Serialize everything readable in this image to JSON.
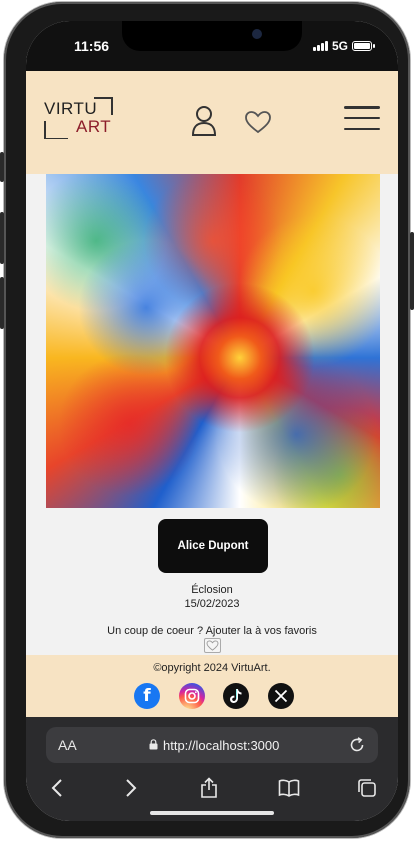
{
  "status_bar": {
    "time": "11:56",
    "network": "5G"
  },
  "header": {
    "logo_top": "VIRTU",
    "logo_bottom": "ART",
    "logo_accent_color": "#8c1d2a",
    "background_color": "#f7e3c3",
    "icons": [
      "user-icon",
      "heart-icon",
      "menu-icon"
    ]
  },
  "artwork": {
    "artist_button_label": "Alice Dupont",
    "title": "Éclosion",
    "date": "15/02/2023",
    "favorite_prompt": "Un coup de coeur ? Ajouter la à vos favoris"
  },
  "footer": {
    "copyright": "©opyright 2024 VirtuArt.",
    "socials": [
      "facebook-icon",
      "instagram-icon",
      "tiktok-icon",
      "x-icon"
    ]
  },
  "browser": {
    "text_size_label": "AA",
    "url": "http://localhost:3000",
    "nav_icons": [
      "back-icon",
      "forward-icon",
      "share-icon",
      "bookmarks-icon",
      "tabs-icon"
    ]
  }
}
